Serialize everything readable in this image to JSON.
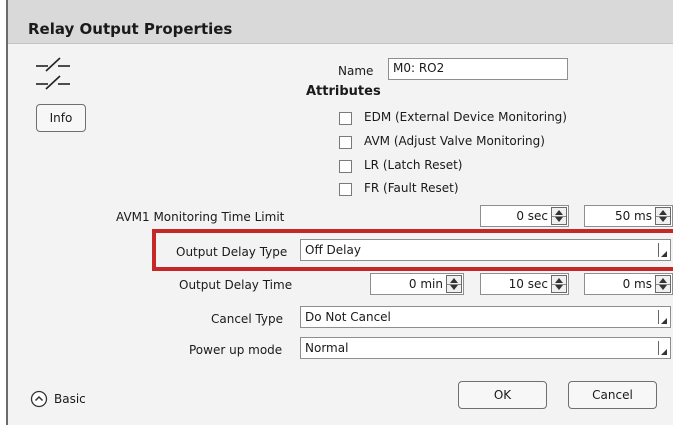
{
  "dialog": {
    "title": "Relay Output Properties",
    "icon": "relay-contact-icon",
    "info_button": "Info",
    "name_label": "Name",
    "name_value": "M0: RO2",
    "attributes_heading": "Attributes",
    "attributes": [
      {
        "label": "EDM (External Device Monitoring)",
        "checked": false
      },
      {
        "label": "AVM (Adjust Valve Monitoring)",
        "checked": false
      },
      {
        "label": "LR (Latch Reset)",
        "checked": false
      },
      {
        "label": "FR (Fault Reset)",
        "checked": false
      }
    ],
    "avm1": {
      "label": "AVM1 Monitoring Time Limit",
      "sec": "0 sec",
      "ms": "50 ms"
    },
    "output_delay_type": {
      "label": "Output Delay Type",
      "value": "Off Delay"
    },
    "output_delay_time": {
      "label": "Output Delay Time",
      "min": "0 min",
      "sec": "10 sec",
      "ms": "0 ms"
    },
    "cancel_type": {
      "label": "Cancel Type",
      "value": "Do Not Cancel"
    },
    "power_up_mode": {
      "label": "Power up mode",
      "value": "Normal"
    },
    "basic_label": "Basic",
    "ok_button": "OK",
    "cancel_button": "Cancel",
    "highlight_color": "#c62828"
  }
}
